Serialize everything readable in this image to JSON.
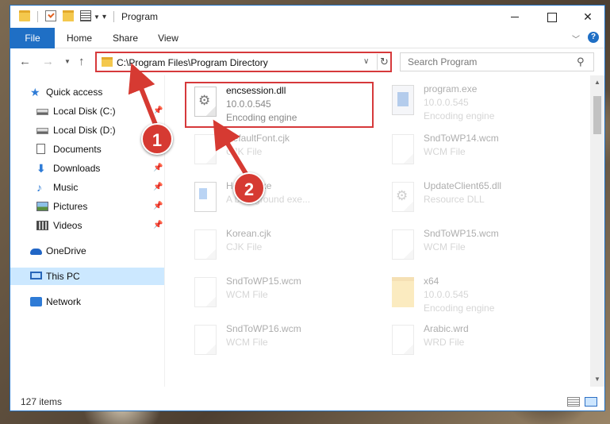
{
  "window": {
    "title": "Program",
    "quick_access_caret": "▾"
  },
  "ribbon": {
    "tabs": [
      {
        "label": "File"
      },
      {
        "label": "Home"
      },
      {
        "label": "Share"
      },
      {
        "label": "View"
      }
    ]
  },
  "nav": {
    "address": "C:\\Program Files\\Program Directory",
    "search_placeholder": "Search Program"
  },
  "sidebar": {
    "items": [
      {
        "label": "Quick access",
        "icon": "star-icon"
      },
      {
        "label": "Local Disk (C:)",
        "icon": "disk-icon",
        "pinned": true
      },
      {
        "label": "Local Disk (D:)",
        "icon": "disk-icon",
        "pinned": false
      },
      {
        "label": "Documents",
        "icon": "documents-icon",
        "pinned": true
      },
      {
        "label": "Downloads",
        "icon": "downloads-icon",
        "pinned": true
      },
      {
        "label": "Music",
        "icon": "music-icon",
        "pinned": true
      },
      {
        "label": "Pictures",
        "icon": "pictures-icon",
        "pinned": true
      },
      {
        "label": "Videos",
        "icon": "videos-icon",
        "pinned": true
      },
      {
        "label": "OneDrive",
        "icon": "onedrive-icon"
      },
      {
        "label": "This PC",
        "icon": "pc-icon",
        "selected": true
      },
      {
        "label": "Network",
        "icon": "network-icon"
      }
    ]
  },
  "files": [
    {
      "name": "encsession.dll",
      "line2": "10.0.0.545",
      "line3": "Encoding engine",
      "icon": "gear-file-icon",
      "highlighted": true
    },
    {
      "name": "program.exe",
      "line2": "10.0.0.545",
      "line3": "Encoding engine",
      "icon": "exe-icon"
    },
    {
      "name": "DefaultFont.cjk",
      "line2": "CJK File",
      "line3": "",
      "icon": "blank-file-icon"
    },
    {
      "name": "SndToWP14.wcm",
      "line2": "WCM File",
      "line3": "",
      "icon": "blank-file-icon"
    },
    {
      "name": "Helper.exe",
      "line2": "A background exe...",
      "line3": "",
      "icon": "blue-file-icon"
    },
    {
      "name": "UpdateClient65.dll",
      "line2": "Resource DLL",
      "line3": "",
      "icon": "gear-file-icon"
    },
    {
      "name": "Korean.cjk",
      "line2": "CJK File",
      "line3": "",
      "icon": "blank-file-icon"
    },
    {
      "name": "SndToWP15.wcm",
      "line2": "WCM File",
      "line3": "",
      "icon": "blank-file-icon"
    },
    {
      "name": "SndToWP15.wcm",
      "line2": "WCM File",
      "line3": "",
      "icon": "blank-file-icon"
    },
    {
      "name": "x64",
      "line2": "10.0.0.545",
      "line3": "Encoding engine",
      "icon": "folder-icon"
    },
    {
      "name": "SndToWP16.wcm",
      "line2": "WCM File",
      "line3": "",
      "icon": "blank-file-icon"
    },
    {
      "name": "Arabic.wrd",
      "line2": "WRD File",
      "line3": "",
      "icon": "blank-file-icon"
    }
  ],
  "status": {
    "item_count": "127 items"
  },
  "callouts": [
    {
      "label": "1"
    },
    {
      "label": "2"
    }
  ],
  "colors": {
    "accent": "#1f6fc5",
    "highlight_red": "#d6393b",
    "selection": "#cce8ff"
  }
}
